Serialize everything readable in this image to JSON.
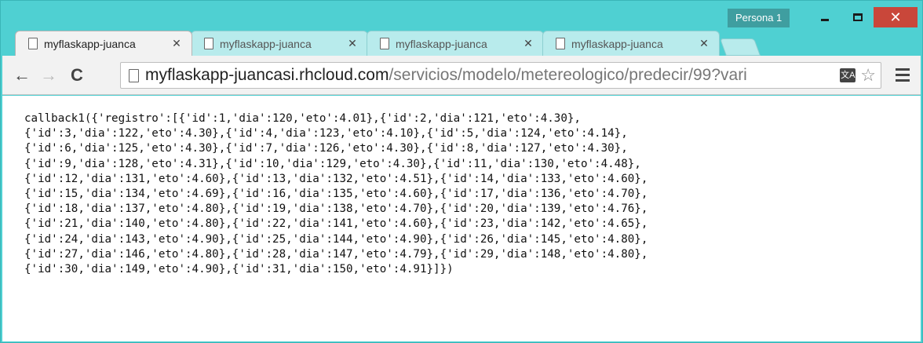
{
  "window": {
    "persona_label": "Persona 1",
    "close_glyph": "✕"
  },
  "tabs": [
    {
      "title": "myflaskapp-juanca",
      "active": true
    },
    {
      "title": "myflaskapp-juanca",
      "active": false
    },
    {
      "title": "myflaskapp-juanca",
      "active": false
    },
    {
      "title": "myflaskapp-juanca",
      "active": false
    }
  ],
  "toolbar": {
    "back_glyph": "←",
    "forward_glyph": "→",
    "reload_glyph": "C",
    "url_host": "myflaskapp-juancasi.rhcloud.com",
    "url_path": "/servicios/modelo/metereologico/predecir/99?vari",
    "translate_label": "文A",
    "star_glyph": "☆"
  },
  "icons": [
    "page-icon",
    "close-icon",
    "minimize-icon",
    "maximize-icon",
    "back-arrow-icon",
    "forward-arrow-icon",
    "reload-icon",
    "translate-icon",
    "star-icon",
    "menu-icon"
  ],
  "content": {
    "lines": [
      "callback1({'registro':[{'id':1,'dia':120,'eto':4.01},{'id':2,'dia':121,'eto':4.30},",
      "{'id':3,'dia':122,'eto':4.30},{'id':4,'dia':123,'eto':4.10},{'id':5,'dia':124,'eto':4.14},",
      "{'id':6,'dia':125,'eto':4.30},{'id':7,'dia':126,'eto':4.30},{'id':8,'dia':127,'eto':4.30},",
      "{'id':9,'dia':128,'eto':4.31},{'id':10,'dia':129,'eto':4.30},{'id':11,'dia':130,'eto':4.48},",
      "{'id':12,'dia':131,'eto':4.60},{'id':13,'dia':132,'eto':4.51},{'id':14,'dia':133,'eto':4.60},",
      "{'id':15,'dia':134,'eto':4.69},{'id':16,'dia':135,'eto':4.60},{'id':17,'dia':136,'eto':4.70},",
      "{'id':18,'dia':137,'eto':4.80},{'id':19,'dia':138,'eto':4.70},{'id':20,'dia':139,'eto':4.76},",
      "{'id':21,'dia':140,'eto':4.80},{'id':22,'dia':141,'eto':4.60},{'id':23,'dia':142,'eto':4.65},",
      "{'id':24,'dia':143,'eto':4.90},{'id':25,'dia':144,'eto':4.90},{'id':26,'dia':145,'eto':4.80},",
      "{'id':27,'dia':146,'eto':4.80},{'id':28,'dia':147,'eto':4.79},{'id':29,'dia':148,'eto':4.80},",
      "{'id':30,'dia':149,'eto':4.90},{'id':31,'dia':150,'eto':4.91}]})"
    ]
  }
}
